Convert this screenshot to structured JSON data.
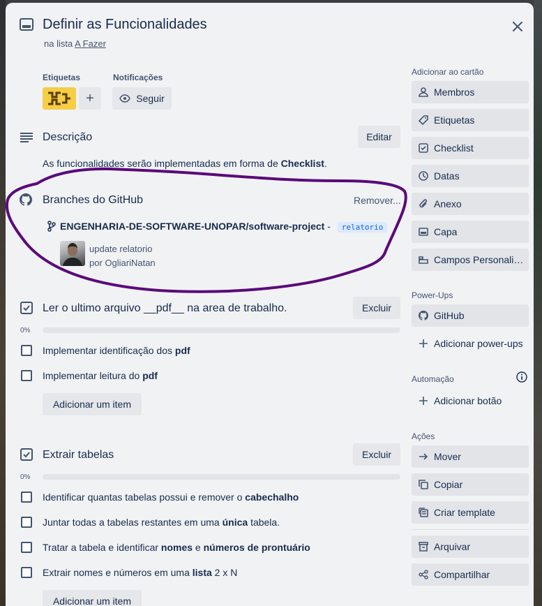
{
  "card": {
    "title": "Definir as Funcionalidades",
    "list_prefix": "na lista",
    "list_name": "A Fazer"
  },
  "labels": {
    "heading": "Etiquetas",
    "add": "+"
  },
  "notifications": {
    "heading": "Notificações",
    "follow": "Seguir"
  },
  "description": {
    "heading": "Descrição",
    "edit": "Editar",
    "text_pre": "As funcionalidades serão implementadas em forma de",
    "text_bold": "Checklist",
    "text_post": "."
  },
  "github": {
    "heading": "Branches do GitHub",
    "remove": "Remover...",
    "repo": "ENGENHARIA-DE-SOFTWARE-UNOPAR/software-project",
    "sep": "-",
    "branch": "relatorio",
    "commit_message": "update relatorio",
    "commit_author": "por OgliariNatan"
  },
  "checklists": [
    {
      "title": "Ler o ultimo arquivo __pdf__ na area de trabalho.",
      "delete": "Excluir",
      "progress": "0%",
      "add_item": "Adicionar um item",
      "items": [
        {
          "pre": "Implementar identificação dos",
          "bold": "pdf",
          "post": ""
        },
        {
          "pre": "Implementar leitura do",
          "bold": "pdf",
          "post": ""
        }
      ]
    },
    {
      "title": "Extrair tabelas",
      "delete": "Excluir",
      "progress": "0%",
      "add_item": "Adicionar um item",
      "items": [
        {
          "pre": "Identificar quantas tabelas possui e remover o",
          "bold": "cabechalho",
          "post": ""
        },
        {
          "pre": "Juntar todas a tabelas restantes em uma",
          "bold": "única",
          "post": "tabela."
        },
        {
          "pre": "Tratar a tabela e identificar",
          "bold": "nomes",
          "mid": "e",
          "bold2": "números de prontuário",
          "post": ""
        },
        {
          "pre": "Extrair nomes e números em uma",
          "bold": "lista",
          "post": "2 x N"
        }
      ]
    }
  ],
  "sidebar": {
    "add_heading": "Adicionar ao cartão",
    "add_items": [
      "Membros",
      "Etiquetas",
      "Checklist",
      "Datas",
      "Anexo",
      "Capa",
      "Campos Personalizados"
    ],
    "powerups_heading": "Power-Ups",
    "powerups_items": [
      "GitHub",
      "Adicionar power-ups"
    ],
    "automation_heading": "Automação",
    "automation_items": [
      "Adicionar botão"
    ],
    "actions_heading": "Ações",
    "actions_items": [
      "Mover",
      "Copiar",
      "Criar template",
      "Arquivar",
      "Compartilhar"
    ]
  },
  "colors": {
    "label_yellow": "#f5cd47",
    "annotation_purple": "#5b0a7a",
    "modal_bg": "#f1f2f4"
  }
}
